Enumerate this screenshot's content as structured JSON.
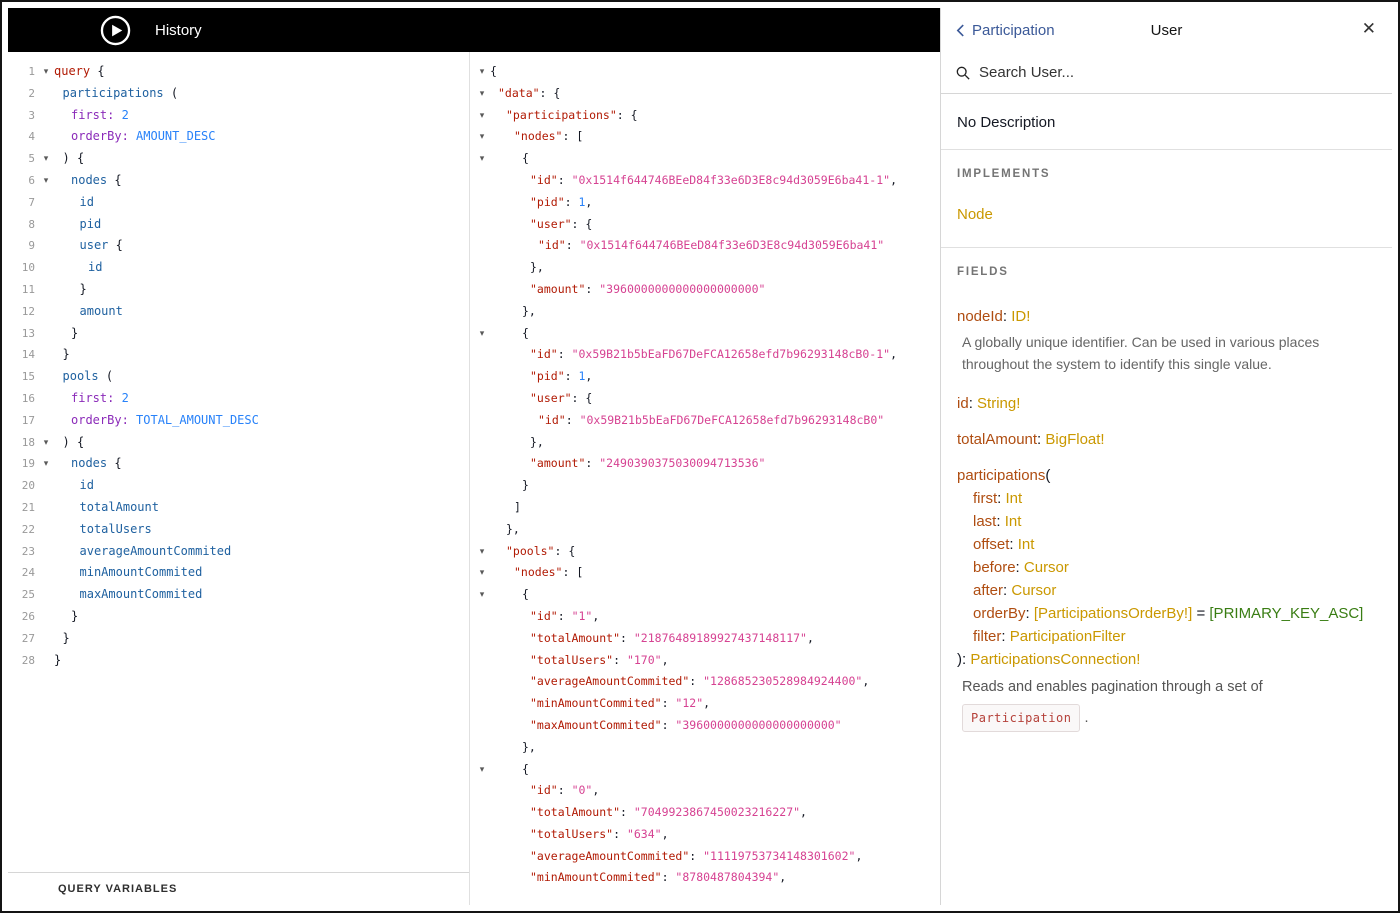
{
  "colors": {
    "topbar_bg": "#000000",
    "kw": "#B11A04",
    "field": "#1F61A0",
    "arg": "#8B2BB9",
    "number": "#2882F9",
    "json_key": "#B11A04",
    "json_string": "#D64292",
    "json_number": "#2882F9",
    "doc_field": "#AF4D11",
    "doc_type": "#CA9800",
    "doc_enum": "#397D13",
    "back_link": "#3B5998"
  },
  "topbar": {
    "history_label": "History"
  },
  "query_editor": {
    "variables_label": "QUERY VARIABLES",
    "lines": [
      {
        "n": "1",
        "i": 0,
        "f": true,
        "s": [
          [
            "kw",
            "query"
          ],
          [
            "pun",
            " {"
          ]
        ]
      },
      {
        "n": "2",
        "i": 1,
        "s": [
          [
            "fld",
            "participations"
          ],
          [
            "pun",
            " ("
          ]
        ]
      },
      {
        "n": "3",
        "i": 2,
        "s": [
          [
            "arg",
            "first:"
          ],
          [
            "pun",
            " "
          ],
          [
            "num",
            "2"
          ]
        ]
      },
      {
        "n": "4",
        "i": 2,
        "s": [
          [
            "arg",
            "orderBy:"
          ],
          [
            "pun",
            " "
          ],
          [
            "enm",
            "AMOUNT_DESC"
          ]
        ]
      },
      {
        "n": "5",
        "i": 1,
        "f": true,
        "s": [
          [
            "pun",
            ") {"
          ]
        ]
      },
      {
        "n": "6",
        "i": 2,
        "f": true,
        "s": [
          [
            "fld",
            "nodes"
          ],
          [
            "pun",
            " {"
          ]
        ]
      },
      {
        "n": "7",
        "i": 3,
        "s": [
          [
            "fld",
            "id"
          ]
        ]
      },
      {
        "n": "8",
        "i": 3,
        "s": [
          [
            "fld",
            "pid"
          ]
        ]
      },
      {
        "n": "9",
        "i": 3,
        "s": [
          [
            "fld",
            "user"
          ],
          [
            "pun",
            " {"
          ]
        ]
      },
      {
        "n": "10",
        "i": 4,
        "s": [
          [
            "fld",
            "id"
          ]
        ]
      },
      {
        "n": "11",
        "i": 3,
        "s": [
          [
            "pun",
            "}"
          ]
        ]
      },
      {
        "n": "12",
        "i": 3,
        "s": [
          [
            "fld",
            "amount"
          ]
        ]
      },
      {
        "n": "13",
        "i": 2,
        "s": [
          [
            "pun",
            "}"
          ]
        ]
      },
      {
        "n": "14",
        "i": 1,
        "s": [
          [
            "pun",
            "}"
          ]
        ]
      },
      {
        "n": "15",
        "i": 1,
        "s": [
          [
            "fld",
            "pools"
          ],
          [
            "pun",
            " ("
          ]
        ]
      },
      {
        "n": "16",
        "i": 2,
        "s": [
          [
            "arg",
            "first:"
          ],
          [
            "pun",
            " "
          ],
          [
            "num",
            "2"
          ]
        ]
      },
      {
        "n": "17",
        "i": 2,
        "s": [
          [
            "arg",
            "orderBy:"
          ],
          [
            "pun",
            " "
          ],
          [
            "enm",
            "TOTAL_AMOUNT_DESC"
          ]
        ]
      },
      {
        "n": "18",
        "i": 1,
        "f": true,
        "s": [
          [
            "pun",
            ") {"
          ]
        ]
      },
      {
        "n": "19",
        "i": 2,
        "f": true,
        "s": [
          [
            "fld",
            "nodes"
          ],
          [
            "pun",
            " {"
          ]
        ]
      },
      {
        "n": "20",
        "i": 3,
        "s": [
          [
            "fld",
            "id"
          ]
        ]
      },
      {
        "n": "21",
        "i": 3,
        "s": [
          [
            "fld",
            "totalAmount"
          ]
        ]
      },
      {
        "n": "22",
        "i": 3,
        "s": [
          [
            "fld",
            "totalUsers"
          ]
        ]
      },
      {
        "n": "23",
        "i": 3,
        "s": [
          [
            "fld",
            "averageAmountCommited"
          ]
        ]
      },
      {
        "n": "24",
        "i": 3,
        "s": [
          [
            "fld",
            "minAmountCommited"
          ]
        ]
      },
      {
        "n": "25",
        "i": 3,
        "s": [
          [
            "fld",
            "maxAmountCommited"
          ]
        ]
      },
      {
        "n": "26",
        "i": 2,
        "s": [
          [
            "pun",
            "}"
          ]
        ]
      },
      {
        "n": "27",
        "i": 1,
        "s": [
          [
            "pun",
            "}"
          ]
        ]
      },
      {
        "n": "28",
        "i": 0,
        "s": [
          [
            "pun",
            "}"
          ]
        ]
      }
    ]
  },
  "result_viewer": {
    "lines": [
      {
        "i": 0,
        "f": true,
        "s": [
          [
            "pun",
            "{"
          ]
        ]
      },
      {
        "i": 1,
        "f": true,
        "s": [
          [
            "rkey",
            "\"data\""
          ],
          [
            "pun",
            ": {"
          ]
        ]
      },
      {
        "i": 2,
        "f": true,
        "s": [
          [
            "rkey",
            "\"participations\""
          ],
          [
            "pun",
            ": {"
          ]
        ]
      },
      {
        "i": 3,
        "f": true,
        "s": [
          [
            "rkey",
            "\"nodes\""
          ],
          [
            "pun",
            ": ["
          ]
        ]
      },
      {
        "i": 4,
        "f": true,
        "s": [
          [
            "pun",
            "{"
          ]
        ]
      },
      {
        "i": 5,
        "s": [
          [
            "rkey",
            "\"id\""
          ],
          [
            "pun",
            ": "
          ],
          [
            "rstr",
            "\"0x1514f644746BEeD84f33e6D3E8c94d3059E6ba41-1\""
          ],
          [
            "pun",
            ","
          ]
        ]
      },
      {
        "i": 5,
        "s": [
          [
            "rkey",
            "\"pid\""
          ],
          [
            "pun",
            ": "
          ],
          [
            "rnum",
            "1"
          ],
          [
            "pun",
            ","
          ]
        ]
      },
      {
        "i": 5,
        "s": [
          [
            "rkey",
            "\"user\""
          ],
          [
            "pun",
            ": {"
          ]
        ]
      },
      {
        "i": 6,
        "s": [
          [
            "rkey",
            "\"id\""
          ],
          [
            "pun",
            ": "
          ],
          [
            "rstr",
            "\"0x1514f644746BEeD84f33e6D3E8c94d3059E6ba41\""
          ]
        ]
      },
      {
        "i": 5,
        "s": [
          [
            "pun",
            "},"
          ]
        ]
      },
      {
        "i": 5,
        "s": [
          [
            "rkey",
            "\"amount\""
          ],
          [
            "pun",
            ": "
          ],
          [
            "rstr",
            "\"3960000000000000000000\""
          ]
        ]
      },
      {
        "i": 4,
        "s": [
          [
            "pun",
            "},"
          ]
        ]
      },
      {
        "i": 4,
        "f": true,
        "s": [
          [
            "pun",
            "{"
          ]
        ]
      },
      {
        "i": 5,
        "s": [
          [
            "rkey",
            "\"id\""
          ],
          [
            "pun",
            ": "
          ],
          [
            "rstr",
            "\"0x59B21b5bEaFD67DeFCA12658efd7b96293148cB0-1\""
          ],
          [
            "pun",
            ","
          ]
        ]
      },
      {
        "i": 5,
        "s": [
          [
            "rkey",
            "\"pid\""
          ],
          [
            "pun",
            ": "
          ],
          [
            "rnum",
            "1"
          ],
          [
            "pun",
            ","
          ]
        ]
      },
      {
        "i": 5,
        "s": [
          [
            "rkey",
            "\"user\""
          ],
          [
            "pun",
            ": {"
          ]
        ]
      },
      {
        "i": 6,
        "s": [
          [
            "rkey",
            "\"id\""
          ],
          [
            "pun",
            ": "
          ],
          [
            "rstr",
            "\"0x59B21b5bEaFD67DeFCA12658efd7b96293148cB0\""
          ]
        ]
      },
      {
        "i": 5,
        "s": [
          [
            "pun",
            "},"
          ]
        ]
      },
      {
        "i": 5,
        "s": [
          [
            "rkey",
            "\"amount\""
          ],
          [
            "pun",
            ": "
          ],
          [
            "rstr",
            "\"2490390375030094713536\""
          ]
        ]
      },
      {
        "i": 4,
        "s": [
          [
            "pun",
            "}"
          ]
        ]
      },
      {
        "i": 3,
        "s": [
          [
            "pun",
            "]"
          ]
        ]
      },
      {
        "i": 2,
        "s": [
          [
            "pun",
            "},"
          ]
        ]
      },
      {
        "i": 2,
        "f": true,
        "s": [
          [
            "rkey",
            "\"pools\""
          ],
          [
            "pun",
            ": {"
          ]
        ]
      },
      {
        "i": 3,
        "f": true,
        "s": [
          [
            "rkey",
            "\"nodes\""
          ],
          [
            "pun",
            ": ["
          ]
        ]
      },
      {
        "i": 4,
        "f": true,
        "s": [
          [
            "pun",
            "{"
          ]
        ]
      },
      {
        "i": 5,
        "s": [
          [
            "rkey",
            "\"id\""
          ],
          [
            "pun",
            ": "
          ],
          [
            "rstr",
            "\"1\""
          ],
          [
            "pun",
            ","
          ]
        ]
      },
      {
        "i": 5,
        "s": [
          [
            "rkey",
            "\"totalAmount\""
          ],
          [
            "pun",
            ": "
          ],
          [
            "rstr",
            "\"21876489189927437148117\""
          ],
          [
            "pun",
            ","
          ]
        ]
      },
      {
        "i": 5,
        "s": [
          [
            "rkey",
            "\"totalUsers\""
          ],
          [
            "pun",
            ": "
          ],
          [
            "rstr",
            "\"170\""
          ],
          [
            "pun",
            ","
          ]
        ]
      },
      {
        "i": 5,
        "s": [
          [
            "rkey",
            "\"averageAmountCommited\""
          ],
          [
            "pun",
            ": "
          ],
          [
            "rstr",
            "\"128685230528984924400\""
          ],
          [
            "pun",
            ","
          ]
        ]
      },
      {
        "i": 5,
        "s": [
          [
            "rkey",
            "\"minAmountCommited\""
          ],
          [
            "pun",
            ": "
          ],
          [
            "rstr",
            "\"12\""
          ],
          [
            "pun",
            ","
          ]
        ]
      },
      {
        "i": 5,
        "s": [
          [
            "rkey",
            "\"maxAmountCommited\""
          ],
          [
            "pun",
            ": "
          ],
          [
            "rstr",
            "\"3960000000000000000000\""
          ]
        ]
      },
      {
        "i": 4,
        "s": [
          [
            "pun",
            "},"
          ]
        ]
      },
      {
        "i": 4,
        "f": true,
        "s": [
          [
            "pun",
            "{"
          ]
        ]
      },
      {
        "i": 5,
        "s": [
          [
            "rkey",
            "\"id\""
          ],
          [
            "pun",
            ": "
          ],
          [
            "rstr",
            "\"0\""
          ],
          [
            "pun",
            ","
          ]
        ]
      },
      {
        "i": 5,
        "s": [
          [
            "rkey",
            "\"totalAmount\""
          ],
          [
            "pun",
            ": "
          ],
          [
            "rstr",
            "\"7049923867450023216227\""
          ],
          [
            "pun",
            ","
          ]
        ]
      },
      {
        "i": 5,
        "s": [
          [
            "rkey",
            "\"totalUsers\""
          ],
          [
            "pun",
            ": "
          ],
          [
            "rstr",
            "\"634\""
          ],
          [
            "pun",
            ","
          ]
        ]
      },
      {
        "i": 5,
        "s": [
          [
            "rkey",
            "\"averageAmountCommited\""
          ],
          [
            "pun",
            ": "
          ],
          [
            "rstr",
            "\"11119753734148301602\""
          ],
          [
            "pun",
            ","
          ]
        ]
      },
      {
        "i": 5,
        "s": [
          [
            "rkey",
            "\"minAmountCommited\""
          ],
          [
            "pun",
            ": "
          ],
          [
            "rstr",
            "\"8780487804394\""
          ],
          [
            "pun",
            ","
          ]
        ]
      }
    ]
  },
  "doc_explorer": {
    "back_label": "Participation",
    "title": "User",
    "search_placeholder": "Search User...",
    "no_description": "No Description",
    "implements_header": "IMPLEMENTS",
    "implements_types": [
      "Node"
    ],
    "fields_header": "FIELDS",
    "fields": [
      {
        "lines": [
          {
            "i": 0,
            "s": [
              [
                "dfld",
                "nodeId"
              ],
              [
                "pln",
                ": "
              ],
              [
                "typ",
                "ID!"
              ]
            ]
          }
        ],
        "desc": "A globally unique identifier. Can be used in various places throughout the system to identify this single value."
      },
      {
        "lines": [
          {
            "i": 0,
            "s": [
              [
                "dfld",
                "id"
              ],
              [
                "pln",
                ": "
              ],
              [
                "typ",
                "String!"
              ]
            ]
          }
        ]
      },
      {
        "lines": [
          {
            "i": 0,
            "s": [
              [
                "dfld",
                "totalAmount"
              ],
              [
                "pln",
                ": "
              ],
              [
                "typ",
                "BigFloat!"
              ]
            ]
          }
        ]
      },
      {
        "lines": [
          {
            "i": 0,
            "s": [
              [
                "dfld",
                "participations"
              ],
              [
                "pln",
                "("
              ]
            ]
          },
          {
            "i": 1,
            "s": [
              [
                "darg",
                "first"
              ],
              [
                "pln",
                ": "
              ],
              [
                "typ",
                "Int"
              ]
            ]
          },
          {
            "i": 1,
            "s": [
              [
                "darg",
                "last"
              ],
              [
                "pln",
                ": "
              ],
              [
                "typ",
                "Int"
              ]
            ]
          },
          {
            "i": 1,
            "s": [
              [
                "darg",
                "offset"
              ],
              [
                "pln",
                ": "
              ],
              [
                "typ",
                "Int"
              ]
            ]
          },
          {
            "i": 1,
            "s": [
              [
                "darg",
                "before"
              ],
              [
                "pln",
                ": "
              ],
              [
                "typ",
                "Cursor"
              ]
            ]
          },
          {
            "i": 1,
            "s": [
              [
                "darg",
                "after"
              ],
              [
                "pln",
                ": "
              ],
              [
                "typ",
                "Cursor"
              ]
            ]
          },
          {
            "i": 1,
            "s": [
              [
                "darg",
                "orderBy"
              ],
              [
                "pln",
                ": "
              ],
              [
                "typ",
                "[ParticipationsOrderBy!]"
              ],
              [
                "pln",
                " = "
              ],
              [
                "enumv",
                "[PRIMARY_KEY_ASC]"
              ]
            ]
          },
          {
            "i": 1,
            "s": [
              [
                "darg",
                "filter"
              ],
              [
                "pln",
                ": "
              ],
              [
                "typ",
                "ParticipationFilter"
              ]
            ]
          },
          {
            "i": 0,
            "s": [
              [
                "pln",
                "): "
              ],
              [
                "typ",
                "ParticipationsConnection!"
              ]
            ]
          }
        ],
        "desc_rich": {
          "text": "Reads and enables pagination through a set of",
          "code": "Participation",
          "after": "."
        }
      }
    ]
  }
}
